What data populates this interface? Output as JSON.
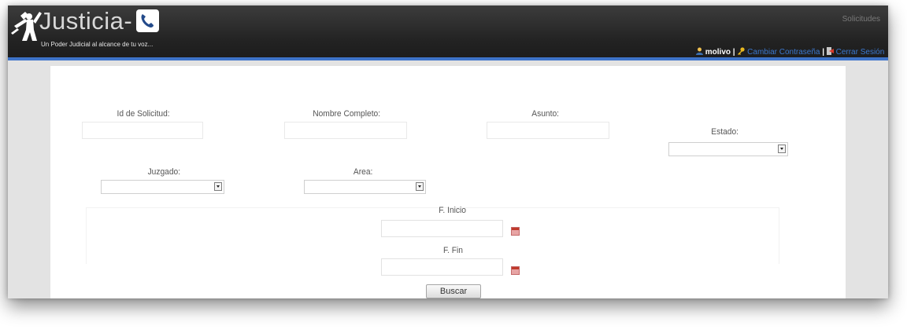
{
  "header": {
    "logo_text": "Justicia-",
    "tagline": "Un Poder Judicial al alcance de tu voz...",
    "nav_link": "Solicitudes",
    "username": "molivo",
    "change_password": "Cambiar Contraseña",
    "logout": "Cerrar Sesión",
    "separator": "|",
    "accent_color": "#3e73c9"
  },
  "form": {
    "id_label": "Id de Solicitud:",
    "nombre_label": "Nombre Completo:",
    "asunto_label": "Asunto:",
    "estado_label": "Estado:",
    "juzgado_label": "Juzgado:",
    "area_label": "Area:",
    "inicio_label": "F. Inicio",
    "fin_label": "F. Fin",
    "id_value": "",
    "nombre_value": "",
    "asunto_value": "",
    "inicio_value": "",
    "fin_value": "",
    "buscar_label": "Buscar"
  },
  "icons": {
    "user": "user-icon",
    "key": "key-icon",
    "logout": "logout-icon",
    "calendar": "calendar-icon",
    "dropdown": "chevron-down-icon"
  }
}
